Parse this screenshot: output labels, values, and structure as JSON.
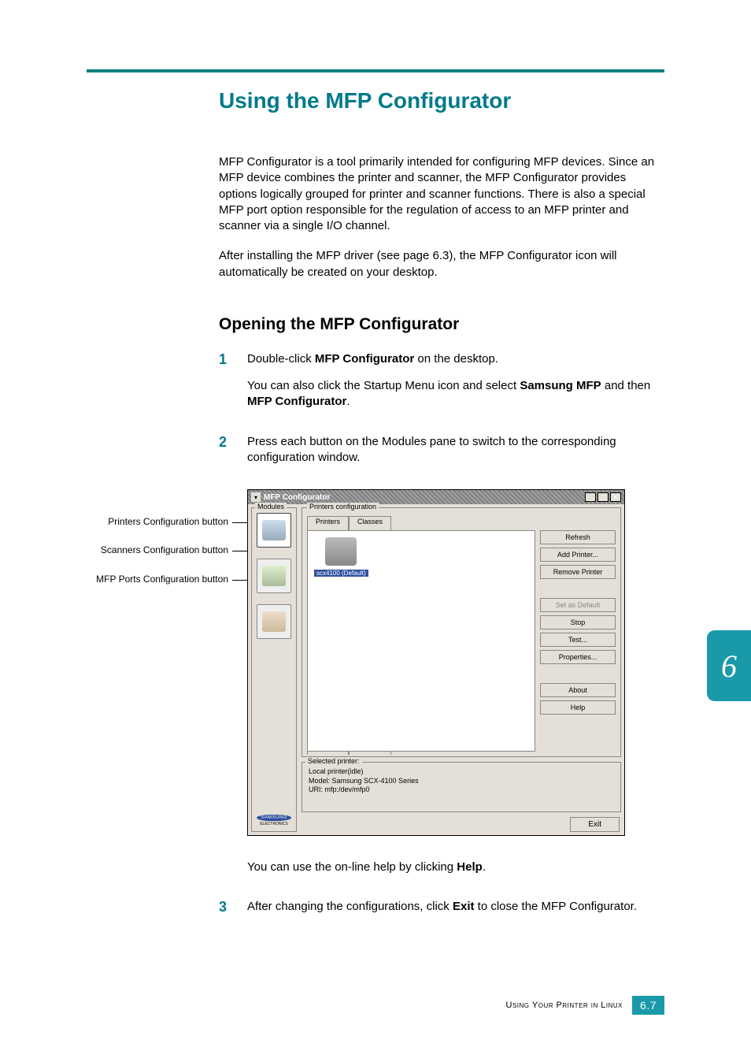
{
  "heading1": "Using the MFP Configurator",
  "intro_para1": "MFP Configurator is a tool primarily intended for configuring MFP devices. Since an MFP device combines the printer and scanner, the MFP Configurator provides options logically grouped for printer and scanner functions. There is also a special MFP port option responsible for the regulation of access to an MFP printer and scanner via a single I/O channel.",
  "intro_para2": "After installing the MFP driver (see page 6.3), the MFP Configurator icon will automatically be created on your desktop.",
  "heading2": "Opening the MFP Configurator",
  "steps": {
    "s1a_pre": "Double-click ",
    "s1a_bold": "MFP Configurator",
    "s1a_post": " on the desktop.",
    "s1b_pre": "You can also click the Startup Menu icon and select ",
    "s1b_bold1": "Samsung MFP",
    "s1b_mid": " and then ",
    "s1b_bold2": "MFP Configurator",
    "s1b_post": ".",
    "s2": "Press each button on the Modules pane to switch to the corresponding configuration window.",
    "s2b_pre": "You can use the on-line help by clicking ",
    "s2b_bold": "Help",
    "s2b_post": ".",
    "s3_pre": "After changing the configurations, click ",
    "s3_bold": "Exit",
    "s3_post": " to close the MFP Configurator."
  },
  "callouts": {
    "c1": "Printers Configuration button",
    "c2": "Scanners Configuration button",
    "c3": "MFP Ports Configuration button"
  },
  "app": {
    "title": "MFP Configurator",
    "modules_label": "Modules",
    "printers_config_label": "Printers configuration",
    "tabs": {
      "printers": "Printers",
      "classes": "Classes"
    },
    "buttons": {
      "refresh": "Refresh",
      "add_printer": "Add Printer...",
      "remove_printer": "Remove Printer",
      "set_default": "Set as Default",
      "stop": "Stop",
      "test": "Test...",
      "properties": "Properties...",
      "about": "About",
      "help": "Help",
      "exit": "Exit"
    },
    "printer_item": "scx4100 (Default)",
    "selected_label": "Selected printer:",
    "selected_line1": "Local printer(idle)",
    "selected_line2": "Model: Samsung SCX-4100 Series",
    "selected_line3": "URI: mfp:/dev/mfp0",
    "brand": "SAMSUNG",
    "brand_sub": "ELECTRONICS"
  },
  "side_tab": "6",
  "footer_text": "Using Your Printer in Linux",
  "page_num": "6.7"
}
